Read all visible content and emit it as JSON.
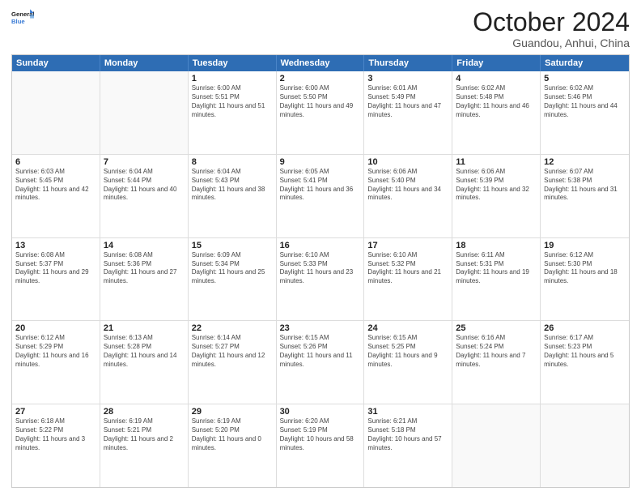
{
  "logo": {
    "line1": "General",
    "line2": "Blue"
  },
  "title": "October 2024",
  "subtitle": "Guandou, Anhui, China",
  "dayHeaders": [
    "Sunday",
    "Monday",
    "Tuesday",
    "Wednesday",
    "Thursday",
    "Friday",
    "Saturday"
  ],
  "weeks": [
    [
      {
        "day": "",
        "info": ""
      },
      {
        "day": "",
        "info": ""
      },
      {
        "day": "1",
        "info": "Sunrise: 6:00 AM\nSunset: 5:51 PM\nDaylight: 11 hours and 51 minutes."
      },
      {
        "day": "2",
        "info": "Sunrise: 6:00 AM\nSunset: 5:50 PM\nDaylight: 11 hours and 49 minutes."
      },
      {
        "day": "3",
        "info": "Sunrise: 6:01 AM\nSunset: 5:49 PM\nDaylight: 11 hours and 47 minutes."
      },
      {
        "day": "4",
        "info": "Sunrise: 6:02 AM\nSunset: 5:48 PM\nDaylight: 11 hours and 46 minutes."
      },
      {
        "day": "5",
        "info": "Sunrise: 6:02 AM\nSunset: 5:46 PM\nDaylight: 11 hours and 44 minutes."
      }
    ],
    [
      {
        "day": "6",
        "info": "Sunrise: 6:03 AM\nSunset: 5:45 PM\nDaylight: 11 hours and 42 minutes."
      },
      {
        "day": "7",
        "info": "Sunrise: 6:04 AM\nSunset: 5:44 PM\nDaylight: 11 hours and 40 minutes."
      },
      {
        "day": "8",
        "info": "Sunrise: 6:04 AM\nSunset: 5:43 PM\nDaylight: 11 hours and 38 minutes."
      },
      {
        "day": "9",
        "info": "Sunrise: 6:05 AM\nSunset: 5:41 PM\nDaylight: 11 hours and 36 minutes."
      },
      {
        "day": "10",
        "info": "Sunrise: 6:06 AM\nSunset: 5:40 PM\nDaylight: 11 hours and 34 minutes."
      },
      {
        "day": "11",
        "info": "Sunrise: 6:06 AM\nSunset: 5:39 PM\nDaylight: 11 hours and 32 minutes."
      },
      {
        "day": "12",
        "info": "Sunrise: 6:07 AM\nSunset: 5:38 PM\nDaylight: 11 hours and 31 minutes."
      }
    ],
    [
      {
        "day": "13",
        "info": "Sunrise: 6:08 AM\nSunset: 5:37 PM\nDaylight: 11 hours and 29 minutes."
      },
      {
        "day": "14",
        "info": "Sunrise: 6:08 AM\nSunset: 5:36 PM\nDaylight: 11 hours and 27 minutes."
      },
      {
        "day": "15",
        "info": "Sunrise: 6:09 AM\nSunset: 5:34 PM\nDaylight: 11 hours and 25 minutes."
      },
      {
        "day": "16",
        "info": "Sunrise: 6:10 AM\nSunset: 5:33 PM\nDaylight: 11 hours and 23 minutes."
      },
      {
        "day": "17",
        "info": "Sunrise: 6:10 AM\nSunset: 5:32 PM\nDaylight: 11 hours and 21 minutes."
      },
      {
        "day": "18",
        "info": "Sunrise: 6:11 AM\nSunset: 5:31 PM\nDaylight: 11 hours and 19 minutes."
      },
      {
        "day": "19",
        "info": "Sunrise: 6:12 AM\nSunset: 5:30 PM\nDaylight: 11 hours and 18 minutes."
      }
    ],
    [
      {
        "day": "20",
        "info": "Sunrise: 6:12 AM\nSunset: 5:29 PM\nDaylight: 11 hours and 16 minutes."
      },
      {
        "day": "21",
        "info": "Sunrise: 6:13 AM\nSunset: 5:28 PM\nDaylight: 11 hours and 14 minutes."
      },
      {
        "day": "22",
        "info": "Sunrise: 6:14 AM\nSunset: 5:27 PM\nDaylight: 11 hours and 12 minutes."
      },
      {
        "day": "23",
        "info": "Sunrise: 6:15 AM\nSunset: 5:26 PM\nDaylight: 11 hours and 11 minutes."
      },
      {
        "day": "24",
        "info": "Sunrise: 6:15 AM\nSunset: 5:25 PM\nDaylight: 11 hours and 9 minutes."
      },
      {
        "day": "25",
        "info": "Sunrise: 6:16 AM\nSunset: 5:24 PM\nDaylight: 11 hours and 7 minutes."
      },
      {
        "day": "26",
        "info": "Sunrise: 6:17 AM\nSunset: 5:23 PM\nDaylight: 11 hours and 5 minutes."
      }
    ],
    [
      {
        "day": "27",
        "info": "Sunrise: 6:18 AM\nSunset: 5:22 PM\nDaylight: 11 hours and 3 minutes."
      },
      {
        "day": "28",
        "info": "Sunrise: 6:19 AM\nSunset: 5:21 PM\nDaylight: 11 hours and 2 minutes."
      },
      {
        "day": "29",
        "info": "Sunrise: 6:19 AM\nSunset: 5:20 PM\nDaylight: 11 hours and 0 minutes."
      },
      {
        "day": "30",
        "info": "Sunrise: 6:20 AM\nSunset: 5:19 PM\nDaylight: 10 hours and 58 minutes."
      },
      {
        "day": "31",
        "info": "Sunrise: 6:21 AM\nSunset: 5:18 PM\nDaylight: 10 hours and 57 minutes."
      },
      {
        "day": "",
        "info": ""
      },
      {
        "day": "",
        "info": ""
      }
    ]
  ]
}
